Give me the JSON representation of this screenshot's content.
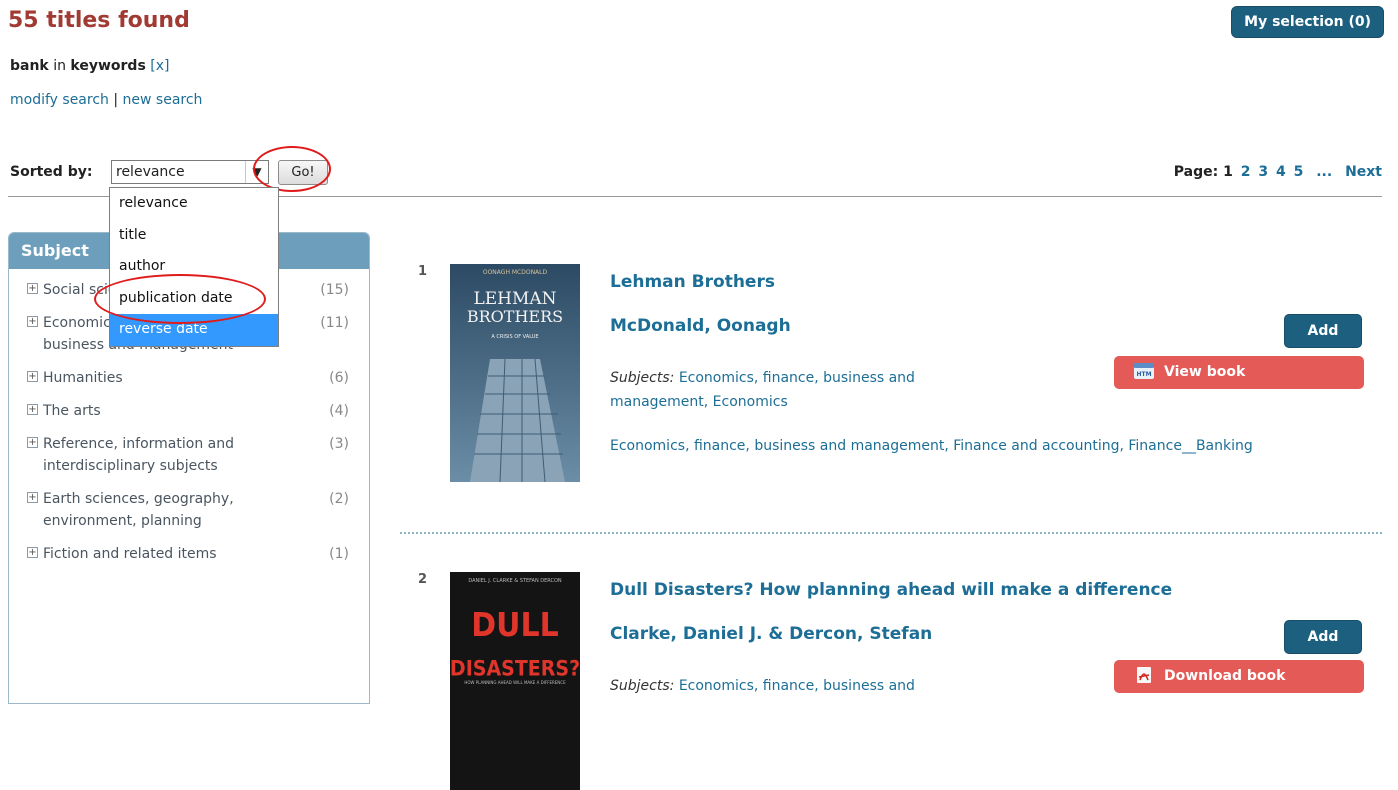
{
  "header": {
    "results_title": "55 titles found",
    "my_selection_label": "My selection (0)"
  },
  "query": {
    "term": "bank",
    "connector": "in",
    "field": "keywords",
    "remove_label": "[x]",
    "modify_label": "modify search",
    "separator": "|",
    "new_label": "new search"
  },
  "sort": {
    "label": "Sorted by:",
    "selected": "relevance",
    "go_label": "Go!",
    "options": [
      "relevance",
      "title",
      "author",
      "publication date",
      "reverse date"
    ],
    "highlighted_index": 4
  },
  "pager": {
    "label": "Page:",
    "current": "1",
    "pages": [
      "2",
      "3",
      "4",
      "5"
    ],
    "ellipsis": "...",
    "next_label": "Next"
  },
  "subjects": {
    "header": "Subject",
    "items": [
      {
        "label": "Social sciences",
        "count": "(15)"
      },
      {
        "label": "Economics, finance, business and management",
        "count": "(11)"
      },
      {
        "label": "Humanities",
        "count": "(6)"
      },
      {
        "label": "The arts",
        "count": "(4)"
      },
      {
        "label": "Reference, information and interdisciplinary subjects",
        "count": "(3)"
      },
      {
        "label": "Earth sciences, geography, environment, planning",
        "count": "(2)"
      },
      {
        "label": "Fiction and related items",
        "count": "(1)"
      }
    ]
  },
  "results": [
    {
      "number": "1",
      "title": "Lehman Brothers",
      "author": "McDonald, Oonagh",
      "subjects_label": "Subjects:",
      "subjects_value": "Economics, finance, business and management, Economics",
      "tags": "Economics, finance, business and management, Finance and accounting, Finance__Banking",
      "add_label": "Add",
      "action_label": "View book",
      "action_icon": "htm-icon",
      "cover": {
        "author": "OONAGH MCDONALD",
        "title_line1": "LEHMAN",
        "title_line2": "BROTHERS",
        "subtitle": "A CRISIS OF VALUE"
      }
    },
    {
      "number": "2",
      "title": "Dull Disasters? How planning ahead will make a difference",
      "author": "Clarke, Daniel J. & Dercon, Stefan",
      "subjects_label": "Subjects:",
      "subjects_value": "Economics, finance, business and",
      "add_label": "Add",
      "action_label": "Download book",
      "action_icon": "pdf-icon",
      "cover": {
        "author": "DANIEL J. CLARKE & STEFAN DERCON",
        "title_line1": "DULL",
        "title_line2": "DISASTERS?",
        "subtitle": "HOW PLANNING AHEAD WILL MAKE A DIFFERENCE"
      }
    }
  ],
  "colors": {
    "title_red": "#a13a33",
    "link_blue": "#1d6e96",
    "button_blue": "#1c5f7e",
    "view_red": "#e35a56",
    "dropdown_highlight": "#3399ff",
    "annotation_red": "#e01b1b"
  }
}
